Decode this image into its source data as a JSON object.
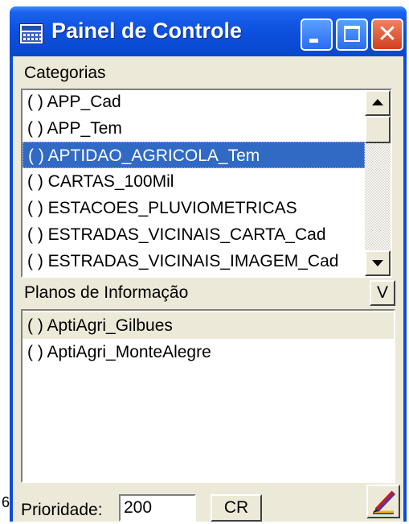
{
  "window": {
    "title": "Painel de Controle",
    "icons": {
      "app": "app-grid-icon",
      "minimize": "minimize-icon",
      "maximize": "maximize-icon",
      "close": "close-icon",
      "close_glyph": "✕"
    }
  },
  "categories": {
    "label": "Categorias",
    "items": [
      "( ) APP_Cad",
      "( ) APP_Tem",
      "( ) APTIDAO_AGRICOLA_Tem",
      "( ) CARTAS_100Mil",
      "( ) ESTACOES_PLUVIOMETRICAS",
      "( ) ESTRADAS_VICINAIS_CARTA_Cad",
      "( ) ESTRADAS_VICINAIS_IMAGEM_Cad"
    ],
    "selected_index": 2
  },
  "planos": {
    "label": "Planos de Informação",
    "toggle_label": "V",
    "items": [
      "( ) AptiAgri_Gilbues",
      "( ) AptiAgri_MonteAlegre"
    ]
  },
  "footer": {
    "priority_label": "Prioridade:",
    "priority_value": "200",
    "cr_label": "CR",
    "edit_icon": "pencil-edit-icon"
  },
  "background": {
    "stray_text": "6"
  },
  "colors": {
    "titlebar": "#0b4fdc",
    "selection": "#316ac5",
    "face": "#ece9d8",
    "close": "#d04020"
  }
}
